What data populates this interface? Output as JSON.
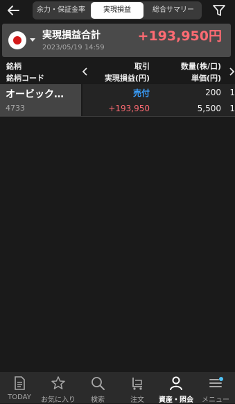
{
  "header": {
    "tabs": [
      {
        "label": "余力・保証金率",
        "active": false
      },
      {
        "label": "実現損益",
        "active": true
      },
      {
        "label": "総合サマリー",
        "active": false
      }
    ],
    "back_icon": "arrow-left-icon",
    "filter_icon": "filter-icon"
  },
  "summary": {
    "title": "実現損益合計",
    "date": "2023/05/19 14:59",
    "total": "+193,950円",
    "market_flag": "japan-flag-icon"
  },
  "table": {
    "headers": {
      "name": "銘柄",
      "code": "銘柄コード",
      "trade": "取引",
      "profit": "実現損益(円)",
      "qty": "数量(株/口)",
      "price": "単価(円)"
    },
    "rows": [
      {
        "name": "オービック…",
        "code": "4733",
        "trade": "売付",
        "profit": "+193,950",
        "qty": "200",
        "price": "5,500",
        "edge_top": "1",
        "edge_bottom": "1"
      }
    ]
  },
  "bottom_nav": [
    {
      "label": "TODAY",
      "icon": "document-icon",
      "active": false
    },
    {
      "label": "お気に入り",
      "icon": "star-icon",
      "active": false
    },
    {
      "label": "検索",
      "icon": "search-icon",
      "active": false
    },
    {
      "label": "注文",
      "icon": "cart-icon",
      "active": false
    },
    {
      "label": "資産・照会",
      "icon": "person-icon",
      "active": true
    },
    {
      "label": "メニュー",
      "icon": "menu-icon",
      "active": false
    }
  ],
  "colors": {
    "profit": "#ff6b73",
    "sell": "#3aa0ff",
    "background": "#1a1a1a"
  }
}
